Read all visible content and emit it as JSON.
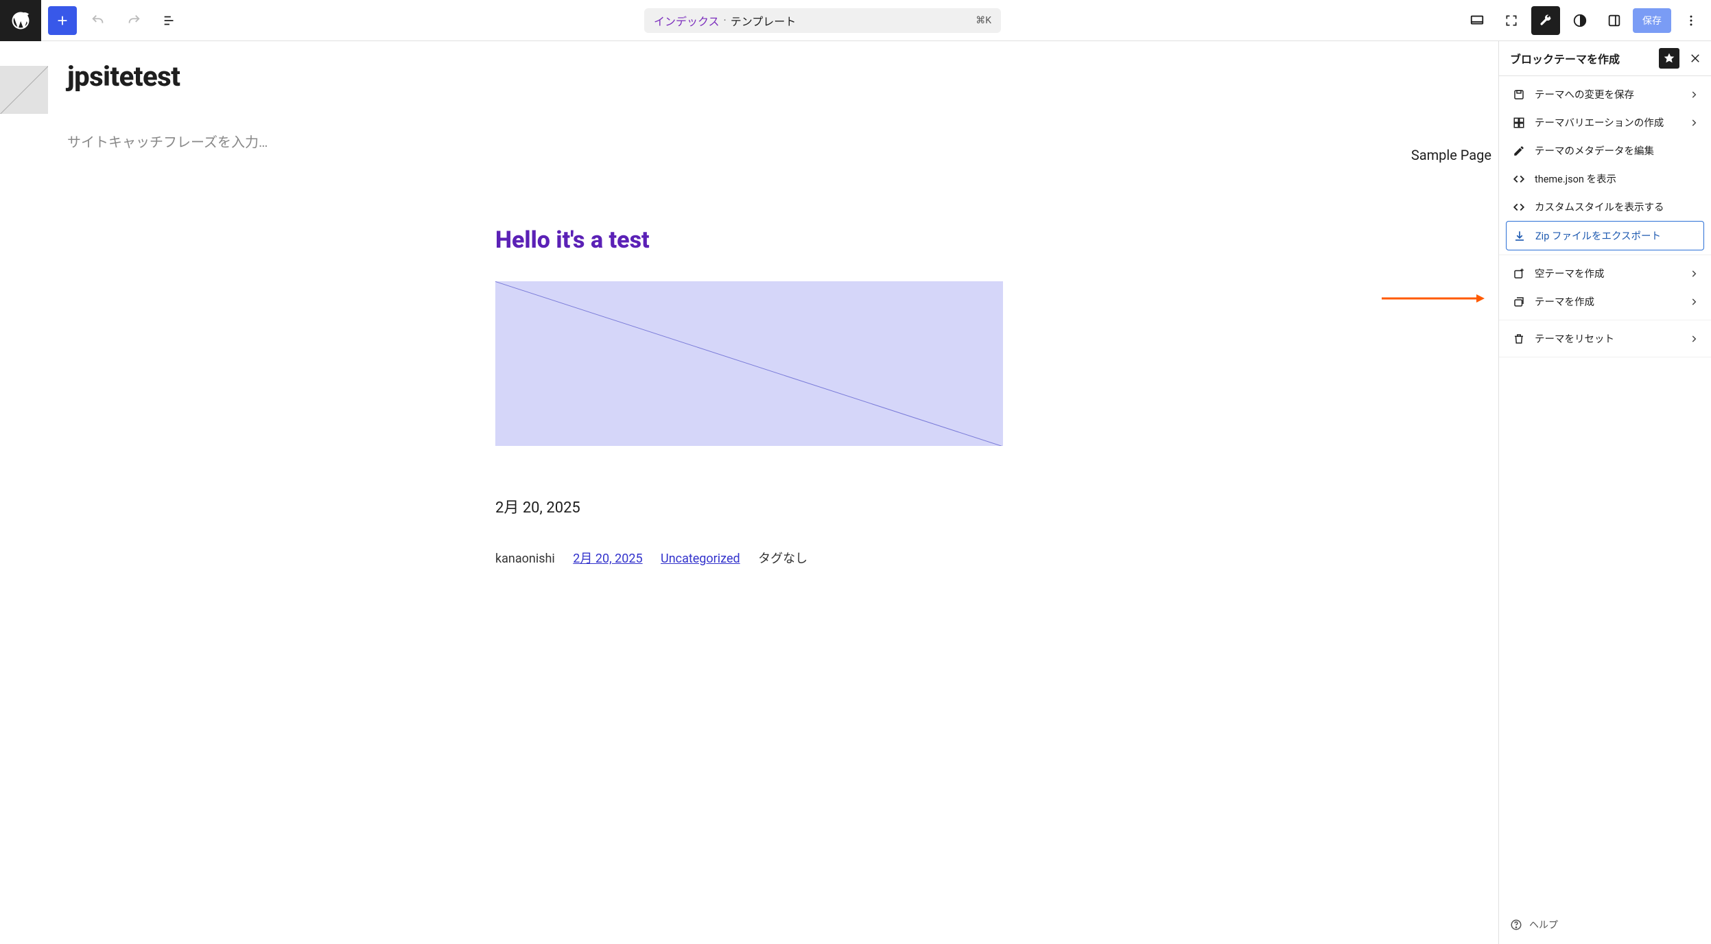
{
  "toolbar": {
    "doc_link_text": "インデックス",
    "doc_sep": "·",
    "doc_type": "テンプレート",
    "shortcut": "⌘K",
    "save_label": "保存"
  },
  "canvas": {
    "site_title": "jpsitetest",
    "site_tagline_placeholder": "サイトキャッチフレーズを入力…",
    "sample_page_label": "Sample Page",
    "post_title": "Hello it's a test",
    "post_date_large": "2月 20, 2025",
    "meta": {
      "author": "kanaonishi",
      "date_link": "2月 20, 2025",
      "category": "Uncategorized",
      "no_tags": "タグなし"
    }
  },
  "sidebar": {
    "title": "ブロックテーマを作成",
    "group1": [
      {
        "label": "テーマへの変更を保存",
        "icon": "save-icon",
        "chevron": true
      },
      {
        "label": "テーマバリエーションの作成",
        "icon": "variation-icon",
        "chevron": true
      },
      {
        "label": "テーマのメタデータを編集",
        "icon": "pencil-icon",
        "chevron": false
      },
      {
        "label": "theme.json を表示",
        "icon": "code-icon",
        "chevron": false
      },
      {
        "label": "カスタムスタイルを表示する",
        "icon": "code-icon",
        "chevron": false
      },
      {
        "label": "Zip ファイルをエクスポート",
        "icon": "download-icon",
        "chevron": false
      }
    ],
    "group2": [
      {
        "label": "空テーマを作成",
        "icon": "new-icon",
        "chevron": true
      },
      {
        "label": "テーマを作成",
        "icon": "stack-icon",
        "chevron": true
      }
    ],
    "group3": [
      {
        "label": "テーマをリセット",
        "icon": "trash-icon",
        "chevron": true
      }
    ],
    "help_label": "ヘルプ"
  }
}
